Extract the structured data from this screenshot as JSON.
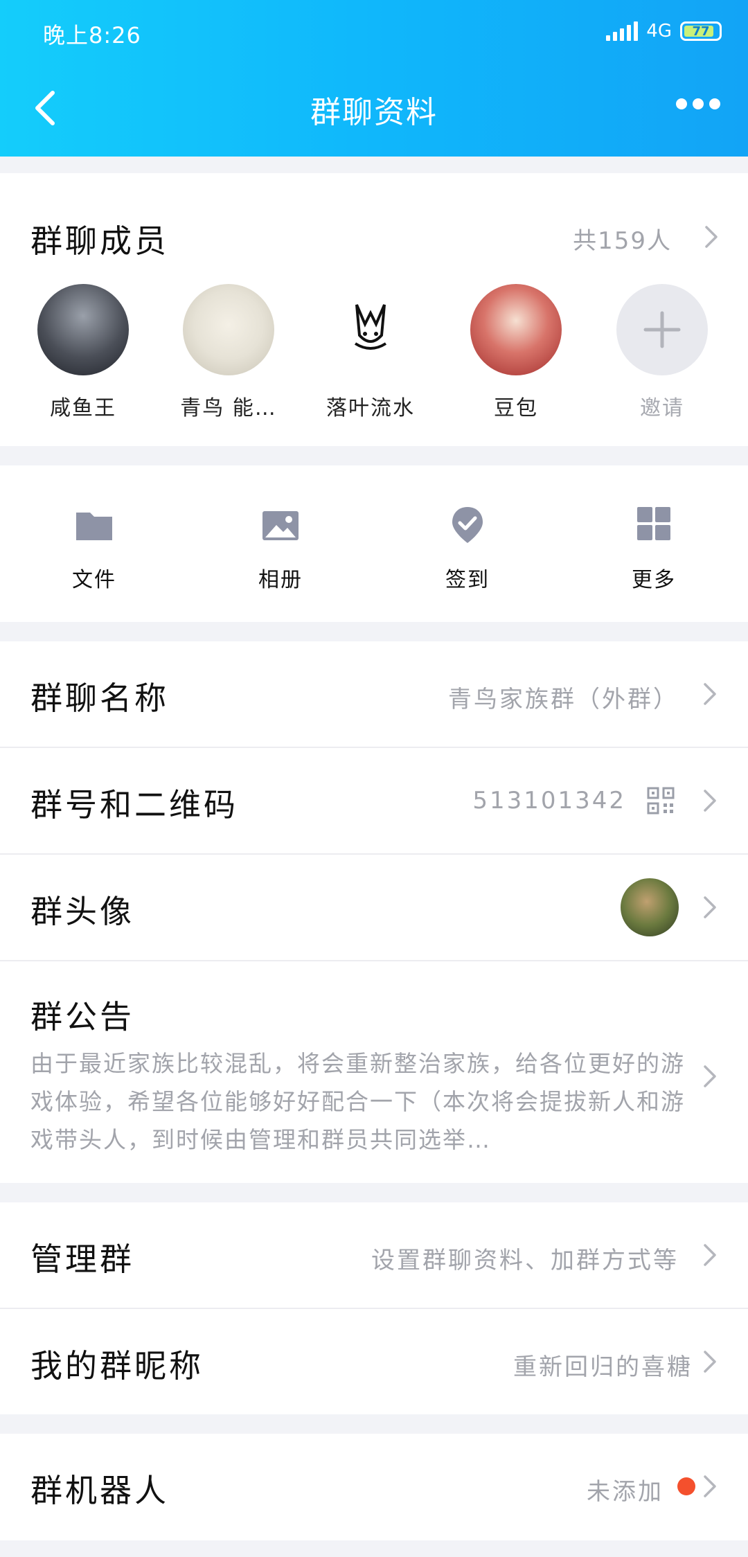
{
  "status_bar": {
    "time": "晚上8:26",
    "network": "4G",
    "battery": "77"
  },
  "nav": {
    "title": "群聊资料"
  },
  "members": {
    "title": "群聊成员",
    "count": "共159人",
    "list": [
      {
        "name": "咸鱼王"
      },
      {
        "name": "青鸟 能…"
      },
      {
        "name": "落叶流水"
      },
      {
        "name": "豆包"
      }
    ],
    "invite_label": "邀请"
  },
  "actions": [
    {
      "label": "文件",
      "icon": "folder-icon"
    },
    {
      "label": "相册",
      "icon": "image-icon"
    },
    {
      "label": "签到",
      "icon": "checkin-icon"
    },
    {
      "label": "更多",
      "icon": "grid-icon"
    }
  ],
  "info": {
    "name_label": "群聊名称",
    "name_value": "青鸟家族群（外群）",
    "number_label": "群号和二维码",
    "number_value": "513101342",
    "avatar_label": "群头像",
    "notice_label": "群公告",
    "notice_text": "由于最近家族比较混乱，将会重新整治家族，给各位更好的游戏体验，希望各位能够好好配合一下（本次将会提拔新人和游戏带头人，到时候由管理和群员共同选举…"
  },
  "manage": {
    "manage_label": "管理群",
    "manage_value": "设置群聊资料、加群方式等",
    "nickname_label": "我的群昵称",
    "nickname_value": "重新回归的喜糖"
  },
  "robot": {
    "label": "群机器人",
    "value": "未添加"
  },
  "colors": {
    "header_start": "#14cdfb",
    "header_end": "#12a4f6",
    "secondary_text": "#a2a4ab",
    "badge_red": "#f4502d"
  }
}
